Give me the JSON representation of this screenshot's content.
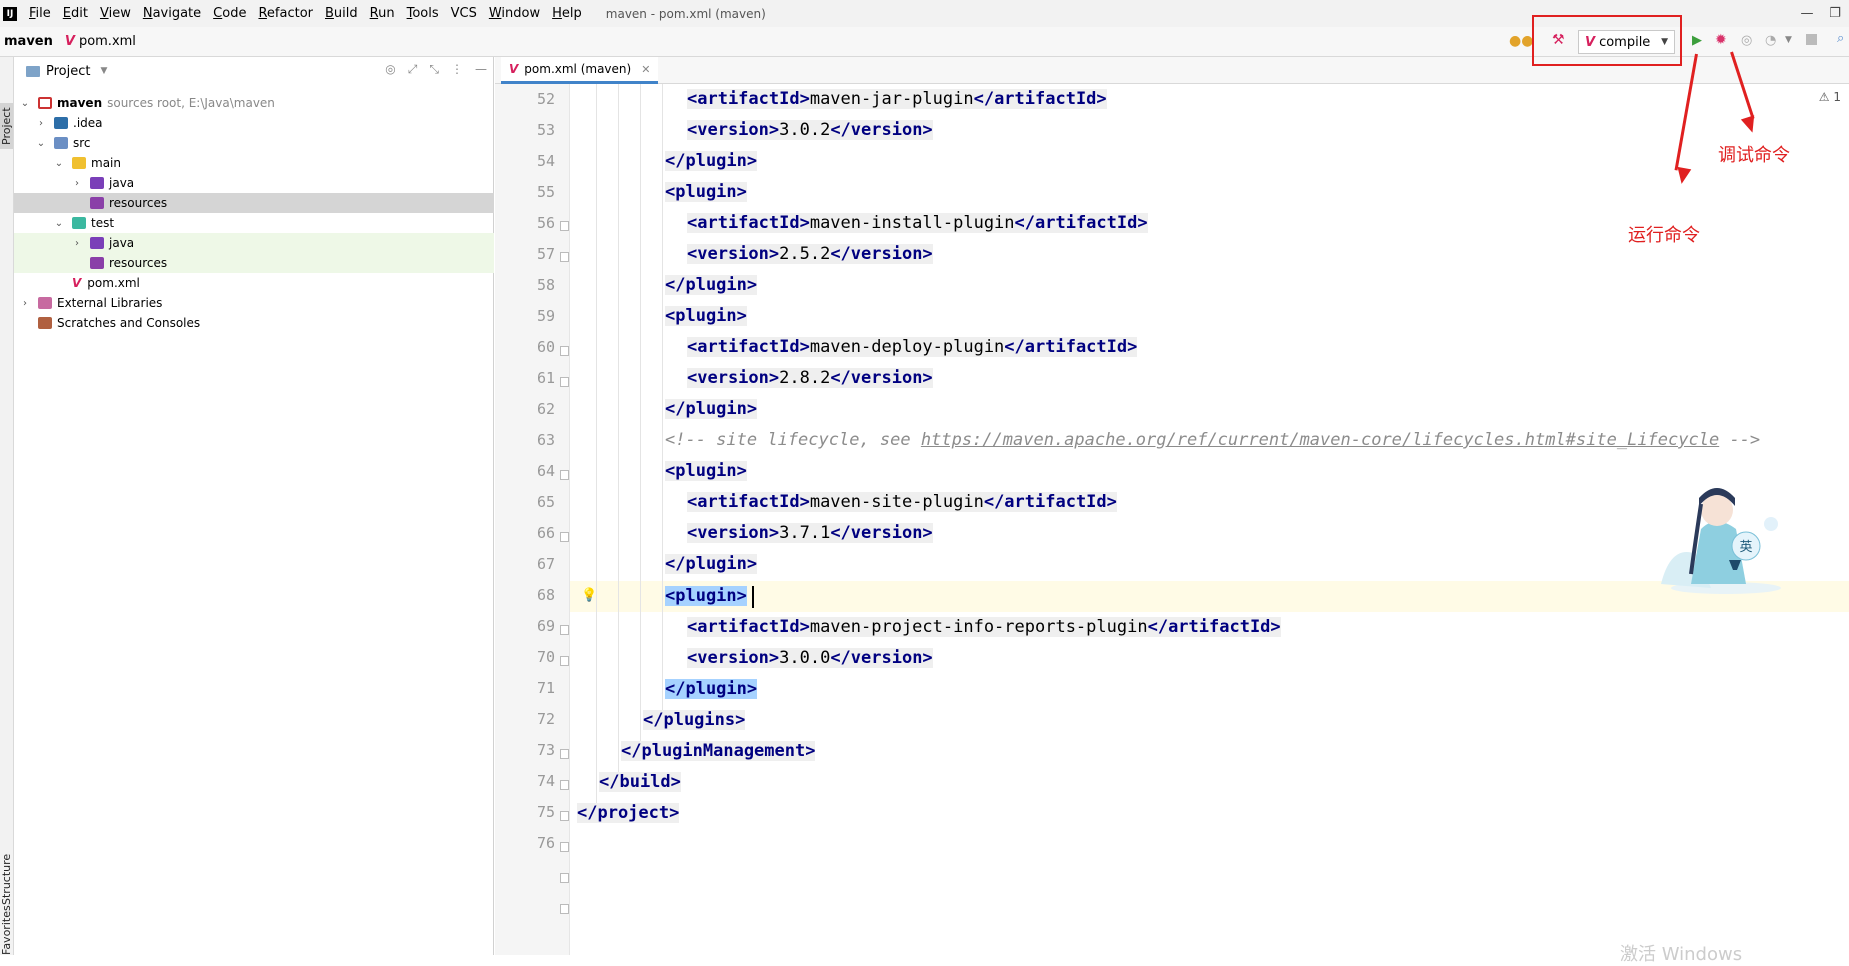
{
  "menubar": {
    "logo": "IJ",
    "items": [
      {
        "u": "F",
        "rest": "ile"
      },
      {
        "u": "E",
        "rest": "dit"
      },
      {
        "u": "V",
        "rest": "iew"
      },
      {
        "u": "N",
        "rest": "avigate"
      },
      {
        "u": "C",
        "rest": "ode"
      },
      {
        "u": "R",
        "rest": "efactor"
      },
      {
        "u": "B",
        "rest": "uild"
      },
      {
        "u": "R",
        "rest": "un"
      },
      {
        "u": "T",
        "rest": "ools"
      },
      {
        "u": "",
        "rest": "VCS"
      },
      {
        "u": "W",
        "rest": "indow"
      },
      {
        "u": "H",
        "rest": "elp"
      }
    ],
    "window_title": "maven - pom.xml (maven)"
  },
  "navbar": {
    "project": "maven",
    "file_icon": "V",
    "file": "pom.xml",
    "run_config": "compile"
  },
  "side_stripe": {
    "project": "Project",
    "structure": "Structure",
    "favorites": "Favorites"
  },
  "project_panel": {
    "title": "Project",
    "tree": [
      {
        "label": "maven",
        "extra": "sources root, E:\\Java\\maven",
        "arrow": "v",
        "icon": "module",
        "level": 0
      },
      {
        "label": ".idea",
        "arrow": ">",
        "icon": "idea",
        "level": 1
      },
      {
        "label": "src",
        "arrow": "v",
        "icon": "src",
        "level": 1
      },
      {
        "label": "main",
        "arrow": "v",
        "icon": "main",
        "level": 2
      },
      {
        "label": "java",
        "arrow": ">",
        "icon": "java",
        "level": 3
      },
      {
        "label": "resources",
        "arrow": "",
        "icon": "res",
        "level": 3
      },
      {
        "label": "test",
        "arrow": "v",
        "icon": "test",
        "level": 2
      },
      {
        "label": "java",
        "arrow": ">",
        "icon": "java",
        "level": 3
      },
      {
        "label": "resources",
        "arrow": "",
        "icon": "res",
        "level": 3
      },
      {
        "label": "pom.xml",
        "arrow": "",
        "icon": "pom",
        "level": 2
      },
      {
        "label": "External Libraries",
        "arrow": ">",
        "icon": "lib",
        "level": 0
      },
      {
        "label": "Scratches and Consoles",
        "arrow": "",
        "icon": "scratch",
        "level": 0
      }
    ]
  },
  "editor": {
    "tab_label": "pom.xml (maven)",
    "warning_count": "1",
    "line_numbers": [
      "52",
      "53",
      "54",
      "55",
      "56",
      "57",
      "58",
      "59",
      "60",
      "61",
      "62",
      "63",
      "64",
      "65",
      "66",
      "67",
      "68",
      "69",
      "70",
      "71",
      "72",
      "73",
      "74",
      "75",
      "76"
    ],
    "lines": {
      "l52_open": "<artifactId>",
      "l52_val": "maven-jar-plugin",
      "l52_close": "</artifactId>",
      "l53_open": "<version>",
      "l53_val": "3.0.2",
      "l53_close": "</version>",
      "l54": "</plugin>",
      "l55": "<plugin>",
      "l56_open": "<artifactId>",
      "l56_val": "maven-install-plugin",
      "l56_close": "</artifactId>",
      "l57_open": "<version>",
      "l57_val": "2.5.2",
      "l57_close": "</version>",
      "l58": "</plugin>",
      "l59": "<plugin>",
      "l60_open": "<artifactId>",
      "l60_val": "maven-deploy-plugin",
      "l60_close": "</artifactId>",
      "l61_open": "<version>",
      "l61_val": "2.8.2",
      "l61_close": "</version>",
      "l62": "</plugin>",
      "l63_a": "<!-- site lifecycle, see ",
      "l63_url": "https://maven.apache.org/ref/current/maven-core/lifecycles.html#site_Lifecycle",
      "l63_b": " -->",
      "l64": "<plugin>",
      "l65_open": "<artifactId>",
      "l65_val": "maven-site-plugin",
      "l65_close": "</artifactId>",
      "l66_open": "<version>",
      "l66_val": "3.7.1",
      "l66_close": "</version>",
      "l67": "</plugin>",
      "l68": "<plugin>",
      "l69_open": "<artifactId>",
      "l69_val": "maven-project-info-reports-plugin",
      "l69_close": "</artifactId>",
      "l70_open": "<version>",
      "l70_val": "3.0.0",
      "l70_close": "</version>",
      "l71": "</plugin>",
      "l72": "</plugins>",
      "l73": "</pluginManagement>",
      "l74": "</build>",
      "l75": "</project>"
    }
  },
  "annotations": {
    "debug": "调试命令",
    "run": "运行命令"
  },
  "mascot_badge": "英",
  "watermark": "激活 Windows",
  "colors": {
    "accent": "#4083c9",
    "annotation": "#e02020",
    "maven": "#d6205d",
    "tag": "#000080"
  }
}
